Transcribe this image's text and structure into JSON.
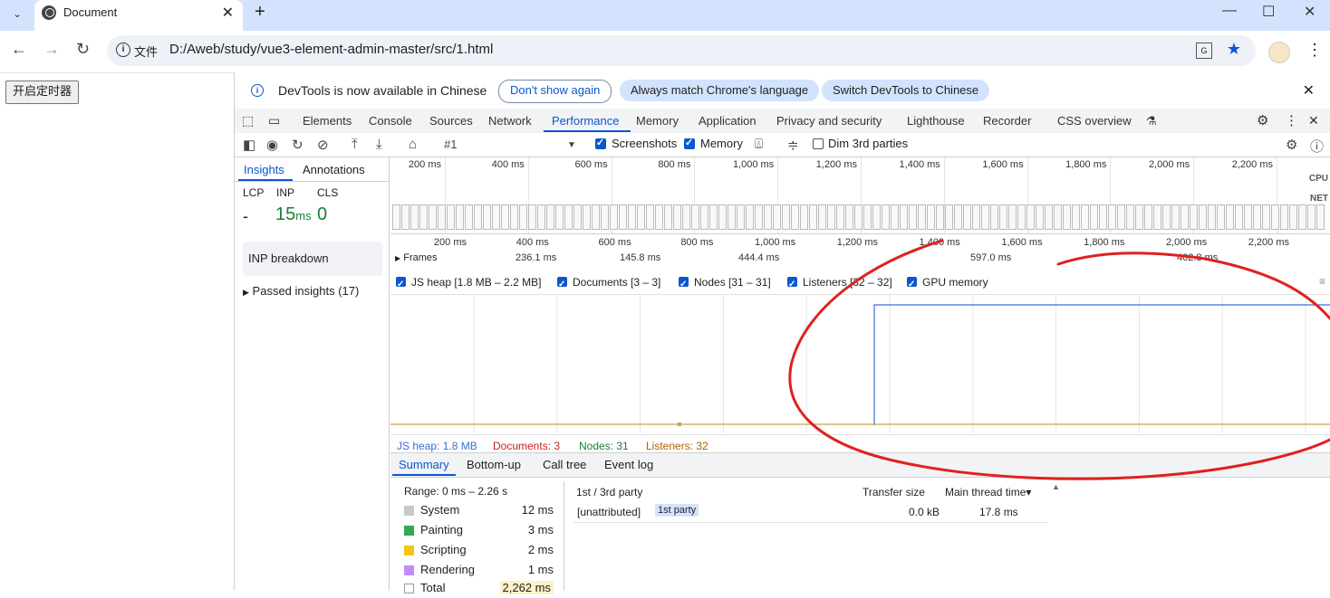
{
  "browser": {
    "tab_title": "Document",
    "new_tab": "+",
    "url_chip": "文件",
    "url": "D:/Aweb/study/vue3-element-admin-master/src/1.html"
  },
  "page": {
    "button_label": "开启定时器"
  },
  "infobar": {
    "message": "DevTools is now available in Chinese",
    "dont_show": "Don't show again",
    "match_language": "Always match Chrome's language",
    "switch": "Switch DevTools to Chinese"
  },
  "devtools_tabs": [
    "Elements",
    "Console",
    "Sources",
    "Network",
    "Performance",
    "Memory",
    "Application",
    "Privacy and security",
    "Lighthouse",
    "Recorder",
    "CSS overview"
  ],
  "active_tab": "Performance",
  "perf_toolbar": {
    "recording": "#1",
    "screenshots": "Screenshots",
    "memory": "Memory",
    "dim": "Dim 3rd parties"
  },
  "sidebar": {
    "tabs": [
      "Insights",
      "Annotations"
    ],
    "metrics": {
      "lcp_label": "LCP",
      "inp_label": "INP",
      "cls_label": "CLS",
      "lcp_value": "-",
      "inp_value": "15",
      "inp_unit": "ms",
      "cls_value": "0"
    },
    "inp_breakdown": "INP breakdown",
    "passed": "Passed insights (17)"
  },
  "overview": {
    "ticks": [
      "200 ms",
      "400 ms",
      "600 ms",
      "800 ms",
      "1,000 ms",
      "1,200 ms",
      "1,400 ms",
      "1,600 ms",
      "1,800 ms",
      "2,000 ms",
      "2,200 ms"
    ],
    "cpu_label": "CPU",
    "net_label": "NET"
  },
  "ruler": {
    "ticks": [
      "200 ms",
      "400 ms",
      "600 ms",
      "800 ms",
      "1,000 ms",
      "1,200 ms",
      "1,400 ms",
      "1,600 ms",
      "1,800 ms",
      "2,000 ms",
      "2,200 ms"
    ],
    "frames_label": "Frames",
    "frame_values": [
      "236.1 ms",
      "145.8 ms",
      "444.4 ms",
      "597.0 ms",
      "402.8 ms"
    ]
  },
  "memory_legend": [
    {
      "label": "JS heap [1.8 MB – 2.2 MB]",
      "color": "#7b9fe0"
    },
    {
      "label": "Documents [3 – 3]",
      "color": "#e38585"
    },
    {
      "label": "Nodes [31 – 31]",
      "color": "#7ed67e"
    },
    {
      "label": "Listeners [32 – 32]",
      "color": "#e6b86e"
    },
    {
      "label": "GPU memory",
      "color": "#da7be0"
    }
  ],
  "memory_values": {
    "js_heap": "JS heap: 1.8 MB",
    "documents": "Documents: 3",
    "nodes": "Nodes: 31",
    "listeners": "Listeners: 32"
  },
  "bottom_tabs": [
    "Summary",
    "Bottom-up",
    "Call tree",
    "Event log"
  ],
  "summary": {
    "range": "Range: 0 ms – 2.26 s",
    "categories": [
      {
        "name": "System",
        "value": "12 ms",
        "color": "#c8c8c8"
      },
      {
        "name": "Painting",
        "value": "3 ms",
        "color": "#34a853"
      },
      {
        "name": "Scripting",
        "value": "2 ms",
        "color": "#f5c518"
      },
      {
        "name": "Rendering",
        "value": "1 ms",
        "color": "#c58af9"
      },
      {
        "name": "Total",
        "value": "2,262 ms",
        "color": "#ffffff"
      }
    ],
    "party_headers": {
      "party": "1st / 3rd party",
      "transfer": "Transfer size",
      "main_thread": "Main thread time▾"
    },
    "party_row": {
      "name": "[unattributed]",
      "badge": "1st party",
      "transfer": "0.0 kB",
      "main_thread": "17.8 ms"
    }
  },
  "colors": {
    "accent": "#0b57d0",
    "annotation": "#e02020"
  }
}
